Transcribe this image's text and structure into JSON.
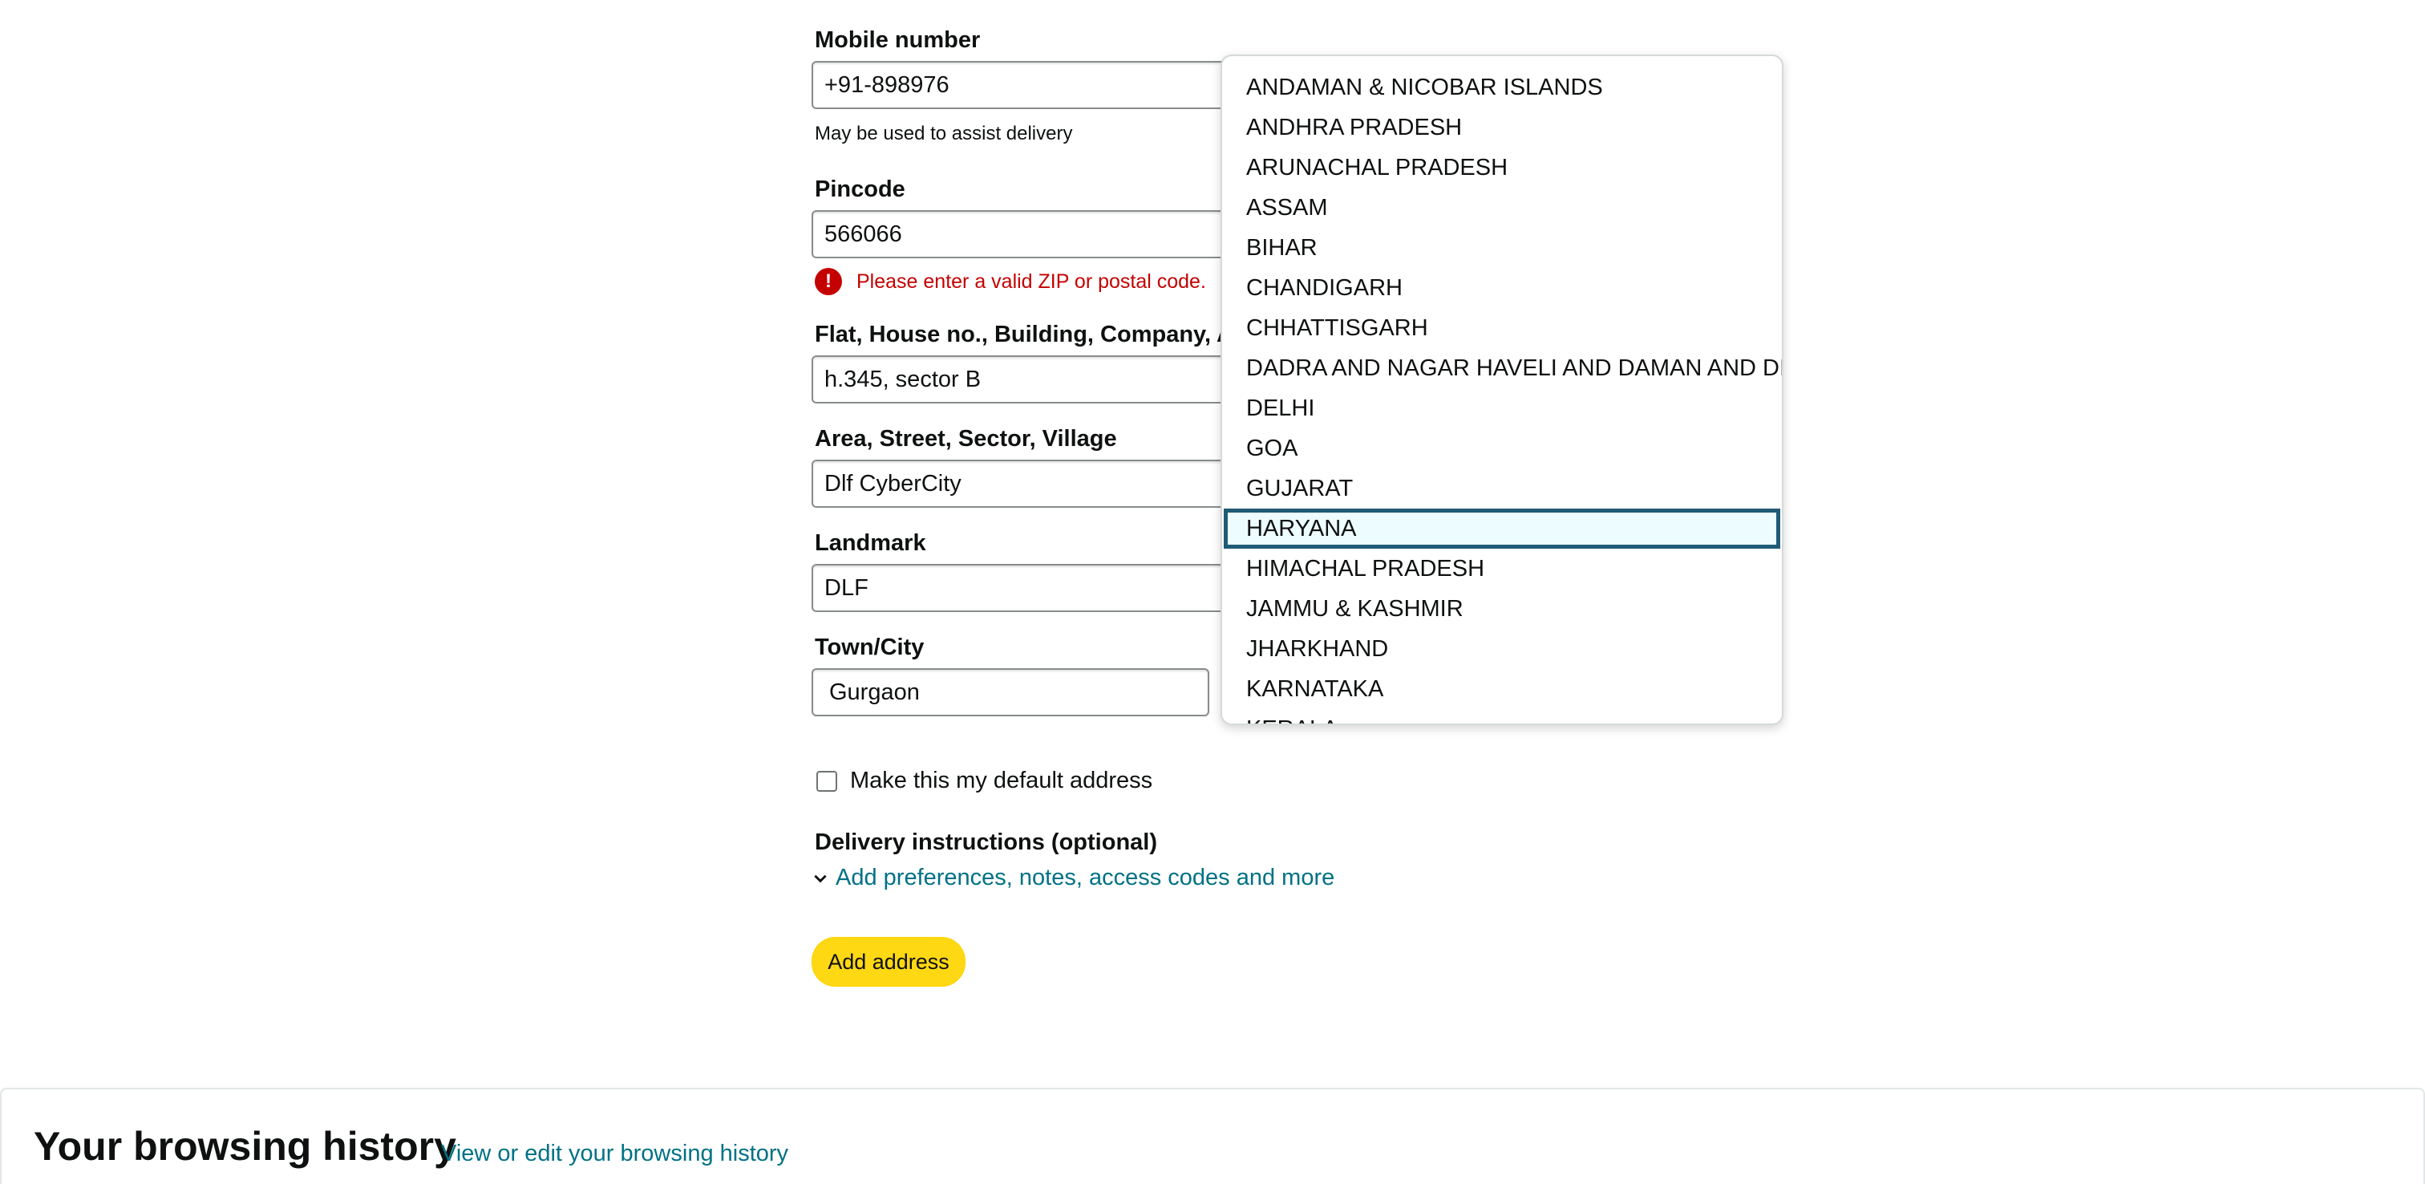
{
  "form": {
    "mobile": {
      "label": "Mobile number",
      "value": "+91-898976",
      "helper": "May be used to assist delivery"
    },
    "pincode": {
      "label": "Pincode",
      "value": "566066",
      "error": "Please enter a valid ZIP or postal code."
    },
    "flat": {
      "label": "Flat, House no., Building, Company, Ap",
      "value": "h.345, sector B"
    },
    "area": {
      "label": "Area, Street, Sector, Village",
      "value": "Dlf CyberCity"
    },
    "landmark": {
      "label": "Landmark",
      "value": "DLF"
    },
    "town": {
      "label": "Town/City",
      "value": "Gurgaon"
    },
    "default_checkbox_label": "Make this my default address",
    "delivery_instructions_title": "Delivery instructions (optional)",
    "delivery_instructions_link": "Add preferences, notes, access codes and more",
    "add_button": "Add address"
  },
  "state_dropdown": {
    "options": [
      "ANDAMAN & NICOBAR ISLANDS",
      "ANDHRA PRADESH",
      "ARUNACHAL PRADESH",
      "ASSAM",
      "BIHAR",
      "CHANDIGARH",
      "CHHATTISGARH",
      "DADRA AND NAGAR HAVELI AND DAMAN AND DIU",
      "DELHI",
      "GOA",
      "GUJARAT",
      "HARYANA",
      "HIMACHAL PRADESH",
      "JAMMU & KASHMIR",
      "JHARKHAND",
      "KARNATAKA",
      "KERALA"
    ],
    "selected": "HARYANA"
  },
  "browsing_history": {
    "title": "Your browsing history",
    "link": "View or edit your browsing history"
  },
  "colors": {
    "link": "#007185",
    "error": "#c40000",
    "button": "#ffd814",
    "selected_border": "#1f5b75"
  },
  "icons": {
    "error": "exclamation-circle-icon",
    "expander": "chevron-down-icon"
  }
}
